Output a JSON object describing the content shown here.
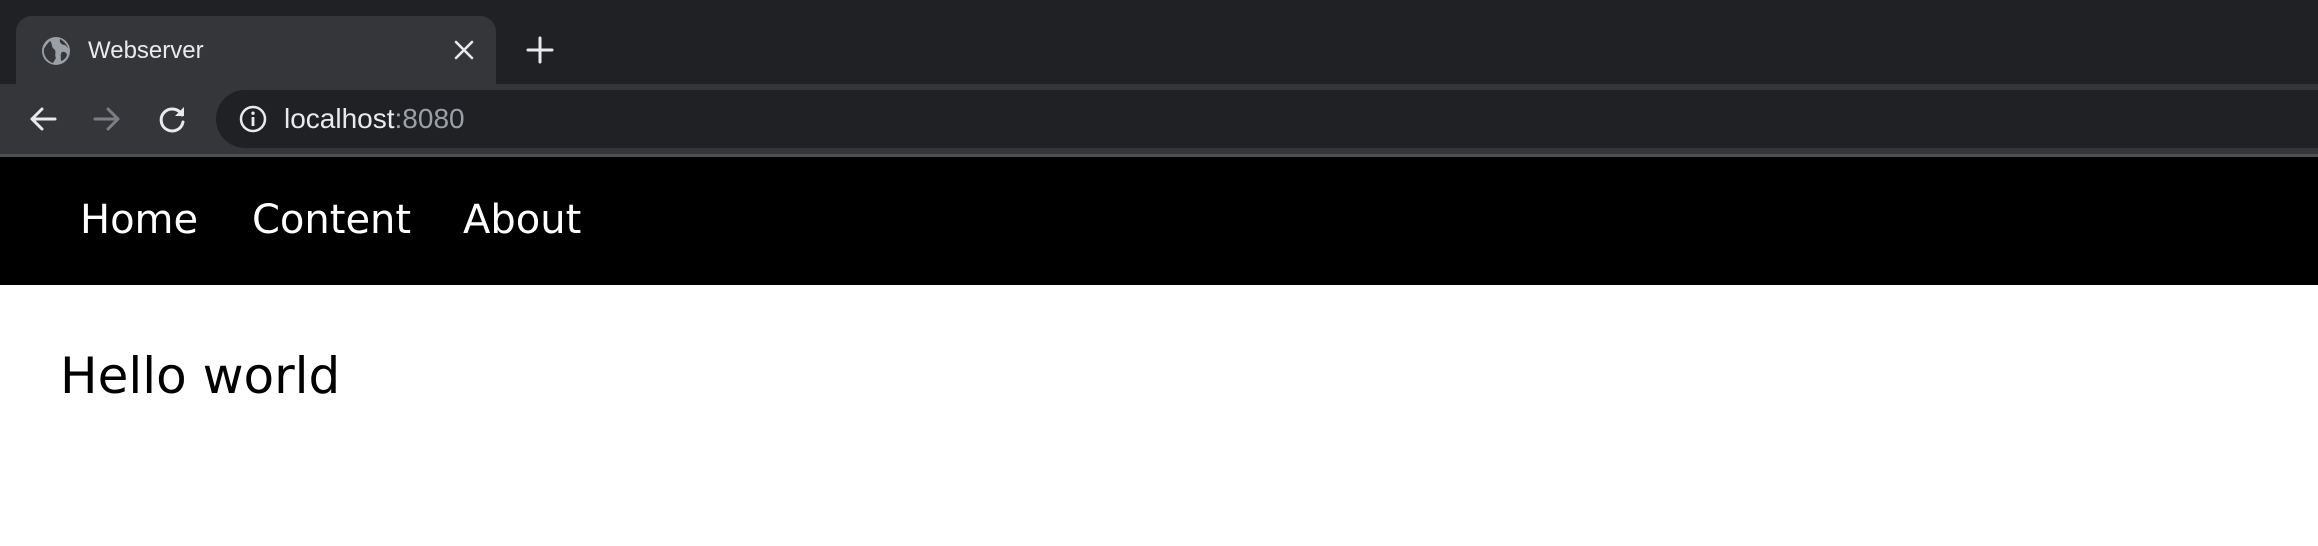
{
  "browser": {
    "tab": {
      "title": "Webserver",
      "favicon_icon": "globe-icon",
      "close_icon": "close-icon"
    },
    "new_tab_icon": "plus-icon",
    "toolbar": {
      "back_icon": "arrow-left-icon",
      "forward_icon": "arrow-right-icon",
      "reload_icon": "reload-icon",
      "site_info_icon": "info-icon",
      "url_host": "localhost",
      "url_port": ":8080"
    },
    "colors": {
      "tabstrip_bg": "#202124",
      "active_tab_bg": "#35363a",
      "omnibox_bg": "#202124",
      "text_primary": "#e8eaed",
      "text_muted": "#9aa0a6"
    }
  },
  "page": {
    "nav": {
      "items": [
        {
          "label": "Home"
        },
        {
          "label": "Content"
        },
        {
          "label": "About"
        }
      ],
      "background": "#000000",
      "text_color": "#ffffff"
    },
    "heading": "Hello world"
  }
}
